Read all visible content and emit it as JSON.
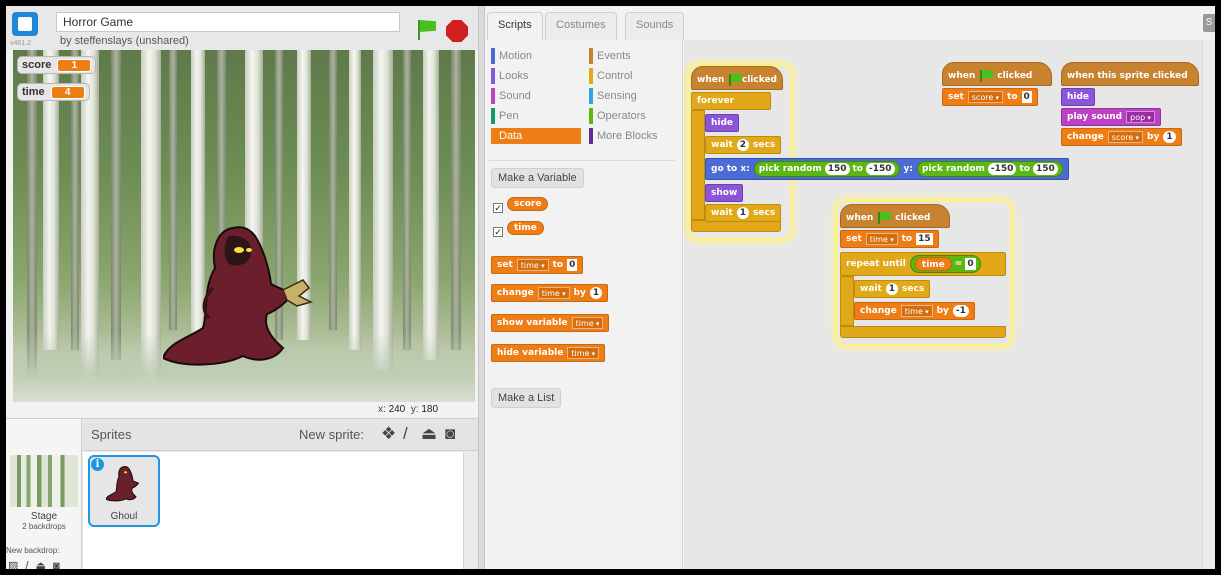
{
  "header": {
    "version": "v461.2",
    "project_title": "Horror Game",
    "author": "by steffenslays (unshared)"
  },
  "stage": {
    "watchers": [
      {
        "name": "score",
        "value": "1"
      },
      {
        "name": "time",
        "value": "4"
      }
    ],
    "coords": {
      "x_label": "x:",
      "x": "240",
      "y_label": "y:",
      "y": "180"
    }
  },
  "sprite_pane": {
    "sprites_title": "Sprites",
    "new_sprite_label": "New sprite:",
    "new_sprite_icons": [
      "paint-icon",
      "brush-icon",
      "upload-icon",
      "camera-icon"
    ],
    "stage_label": "Stage",
    "stage_backdrops": "2 backdrops",
    "new_backdrop_label": "New backdrop:",
    "backdrop_tools": "▨ / ⏏ ◙",
    "sprite_name": "Ghoul"
  },
  "tabs": [
    "Scripts",
    "Costumes",
    "Sounds"
  ],
  "palette": {
    "categories_left": [
      {
        "label": "Motion",
        "color": "#4a6cd4"
      },
      {
        "label": "Looks",
        "color": "#8a55d7"
      },
      {
        "label": "Sound",
        "color": "#bb42c3"
      },
      {
        "label": "Pen",
        "color": "#0e9a6c"
      },
      {
        "label": "Data",
        "color": "#ee7d16"
      }
    ],
    "categories_right": [
      {
        "label": "Events",
        "color": "#c88330"
      },
      {
        "label": "Control",
        "color": "#e1a91a"
      },
      {
        "label": "Sensing",
        "color": "#2ca5e2"
      },
      {
        "label": "Operators",
        "color": "#5cb712"
      },
      {
        "label": "More Blocks",
        "color": "#632d99"
      }
    ],
    "make_variable": "Make a Variable",
    "variables": [
      "score",
      "time"
    ],
    "set_block": {
      "word": "set",
      "var": "time",
      "to": "to",
      "value": "0"
    },
    "change_block": {
      "word": "change",
      "var": "time",
      "by": "by",
      "value": "1"
    },
    "show_var_block": {
      "word": "show variable",
      "var": "time"
    },
    "hide_var_block": {
      "word": "hide variable",
      "var": "time"
    },
    "make_list": "Make a List"
  },
  "scripts": {
    "when_flag": {
      "when": "when",
      "clicked": "clicked"
    },
    "s1": {
      "forever": "forever",
      "hide": "hide",
      "wait1": {
        "word": "wait",
        "value": "2",
        "unit": "secs"
      },
      "goto": {
        "word": "go to x:",
        "rand1": "pick random",
        "a1": "150",
        "to1": "to",
        "b1": "-150",
        "ylabel": "y:",
        "rand2": "pick random",
        "a2": "-150",
        "to2": "to",
        "b2": "150"
      },
      "show": "show",
      "wait2": {
        "word": "wait",
        "value": "1",
        "unit": "secs"
      }
    },
    "s2": {
      "set": "set",
      "var": "score",
      "to": "to",
      "value": "0"
    },
    "s3": {
      "hat": "when this sprite clicked",
      "hide": "hide",
      "play": "play sound",
      "sound": "pop",
      "change": "change",
      "var": "score",
      "by": "by",
      "value": "1"
    },
    "s4": {
      "set": "set",
      "var": "time",
      "to": "to",
      "value": "15",
      "repeat": "repeat until",
      "cond_var": "time",
      "eq": "=",
      "cond_val": "0",
      "wait": "wait",
      "wait_val": "1",
      "secs": "secs",
      "change": "change",
      "ch_var": "time",
      "by": "by",
      "ch_val": "-1"
    }
  }
}
